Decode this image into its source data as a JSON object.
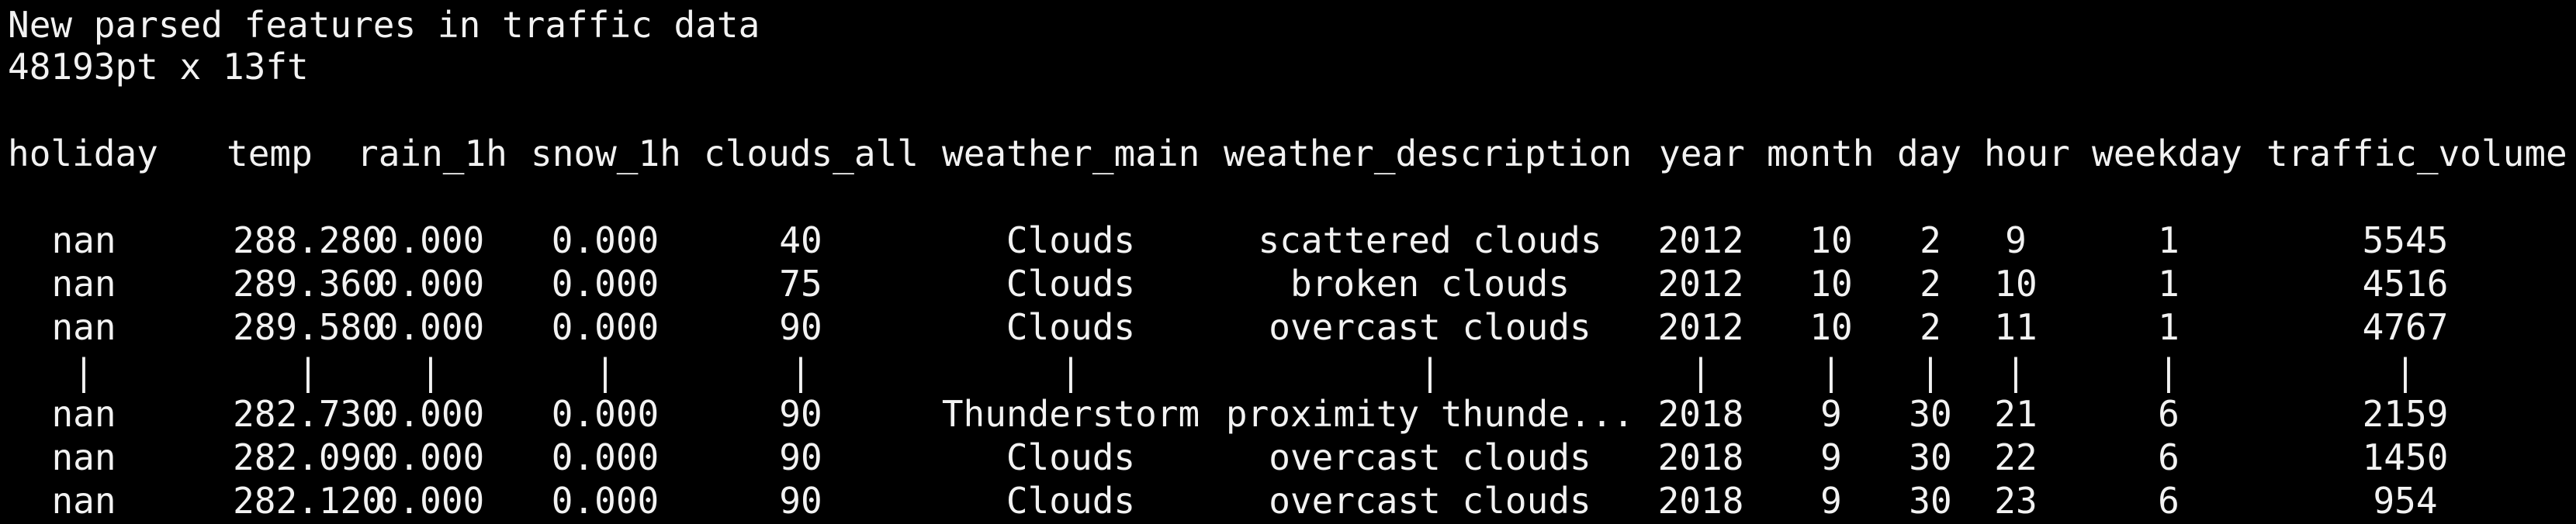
{
  "terminal": {
    "title": "New parsed features in traffic data",
    "shape": "48193pt x 13ft",
    "headers": [
      "holiday",
      "temp",
      "rain_1h",
      "snow_1h",
      "clouds_all",
      "weather_main",
      "weather_description",
      "year",
      "month",
      "day",
      "hour",
      "weekday",
      "traffic_volume"
    ],
    "rows": [
      [
        "nan",
        "288.280",
        "0.000",
        "0.000",
        "40",
        "Clouds",
        "scattered clouds",
        "2012",
        "10",
        "2",
        "9",
        "1",
        "5545"
      ],
      [
        "nan",
        "289.360",
        "0.000",
        "0.000",
        "75",
        "Clouds",
        "broken clouds",
        "2012",
        "10",
        "2",
        "10",
        "1",
        "4516"
      ],
      [
        "nan",
        "289.580",
        "0.000",
        "0.000",
        "90",
        "Clouds",
        "overcast clouds",
        "2012",
        "10",
        "2",
        "11",
        "1",
        "4767"
      ],
      [
        "|",
        "|",
        "|",
        "|",
        "|",
        "|",
        "|",
        "|",
        "|",
        "|",
        "|",
        "|",
        "|"
      ],
      [
        "nan",
        "282.730",
        "0.000",
        "0.000",
        "90",
        "Thunderstorm",
        "proximity thunde...",
        "2018",
        "9",
        "30",
        "21",
        "6",
        "2159"
      ],
      [
        "nan",
        "282.090",
        "0.000",
        "0.000",
        "90",
        "Clouds",
        "overcast clouds",
        "2018",
        "9",
        "30",
        "22",
        "6",
        "1450"
      ],
      [
        "nan",
        "282.120",
        "0.000",
        "0.000",
        "90",
        "Clouds",
        "overcast clouds",
        "2018",
        "9",
        "30",
        "23",
        "6",
        "954"
      ]
    ]
  }
}
